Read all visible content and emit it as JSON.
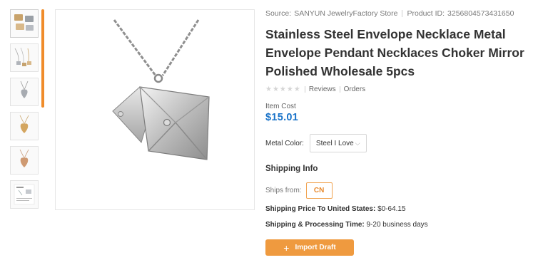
{
  "thumbnails": [
    {
      "icon": "envelope-pendant-multi-thumbnail"
    },
    {
      "icon": "necklace-set-thumbnail"
    },
    {
      "icon": "silver-heart-pendant-thumbnail"
    },
    {
      "icon": "gold-heart-pendant-thumbnail"
    },
    {
      "icon": "rose-gold-pendant-thumbnail"
    },
    {
      "icon": "size-chart-thumbnail"
    }
  ],
  "product": {
    "source_label": "Source:",
    "source_name": "SANYUN JewelryFactory Store",
    "product_id_label": "Product ID:",
    "product_id": "3256804573431650",
    "title": "Stainless Steel Envelope Necklace Metal Envelope Pendant Necklaces Choker Mirror Polished Wholesale 5pcs",
    "stars": "★★★★★",
    "reviews_label": "Reviews",
    "orders_label": "Orders",
    "cost_label": "Item Cost",
    "price": "$15.01"
  },
  "variant": {
    "label": "Metal Color:",
    "selected": "Steel I Love",
    "chevron": "⌵"
  },
  "shipping": {
    "heading": "Shipping Info",
    "ships_from_label": "Ships from:",
    "ships_from_value": "CN",
    "price_label": "Shipping Price To United States:",
    "price_value": "$0-64.15",
    "time_label": "Shipping & Processing Time:",
    "time_value": "9-20 business days"
  },
  "actions": {
    "import_icon": "+",
    "import_label": "Import Draft"
  },
  "colors": {
    "accent": "#ef9a3f",
    "price": "#1a73c9"
  }
}
